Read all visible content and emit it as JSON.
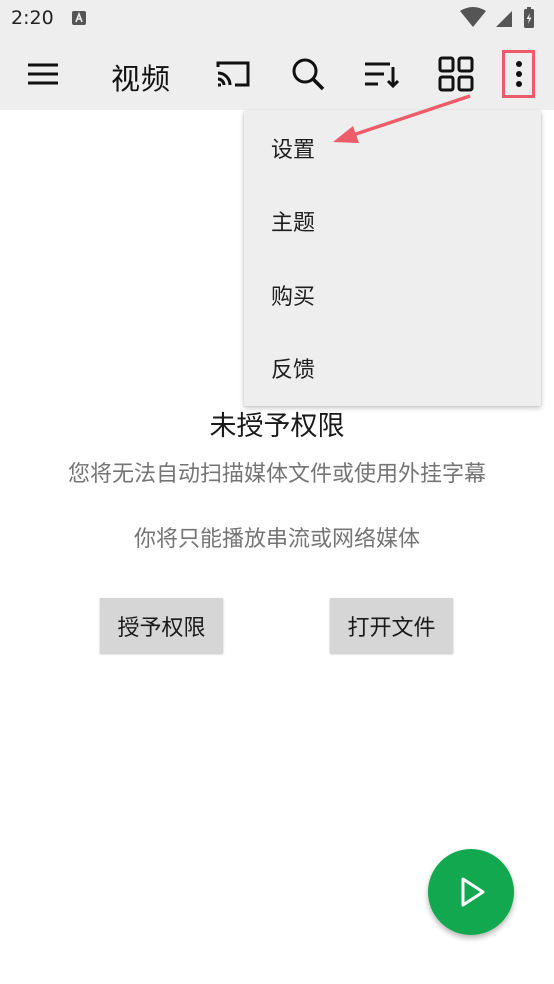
{
  "status_bar": {
    "time": "2:20"
  },
  "app_bar": {
    "title": "视频",
    "icons": [
      "menu-icon",
      "cast-icon",
      "search-icon",
      "sort-icon",
      "grid-view-icon",
      "more-vert-icon"
    ]
  },
  "overflow_menu": {
    "items": [
      {
        "label": "设置"
      },
      {
        "label": "主题"
      },
      {
        "label": "购买"
      },
      {
        "label": "反馈"
      }
    ]
  },
  "permission": {
    "title": "未授予权限",
    "line1": "您将无法自动扫描媒体文件或使用外挂字幕",
    "line2": "你将只能播放串流或网络媒体",
    "grant_button": "授予权限",
    "open_file_button": "打开文件"
  },
  "fab": {
    "icon": "play-icon"
  },
  "colors": {
    "bar_bg": "#eeeeee",
    "fab": "#11a84f",
    "annotation": "#ee5c6a",
    "secondary_text": "#757575",
    "button_bg": "#d6d6d6"
  }
}
